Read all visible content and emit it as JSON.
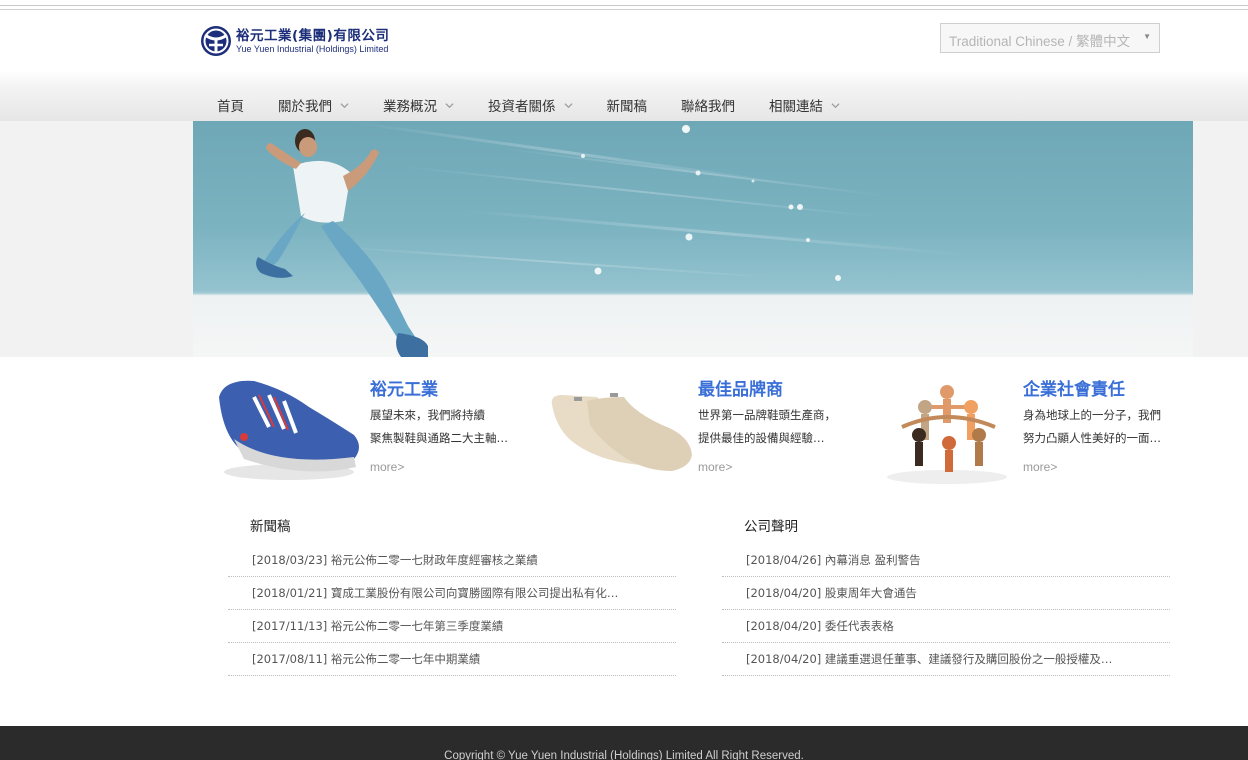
{
  "company": {
    "name_cn": "裕元工業(集團)有限公司",
    "name_en": "Yue Yuen Industrial (Holdings) Limited",
    "brand_color": "#1d2f7a"
  },
  "language": {
    "selected": "Traditional Chinese / 繁體中文"
  },
  "nav": {
    "items": [
      {
        "label": "首頁",
        "icon": ""
      },
      {
        "label": "關於我們",
        "icon": "chevron-down-icon"
      },
      {
        "label": "業務概況",
        "icon": "chevron-down-icon"
      },
      {
        "label": "投資者關係",
        "icon": "chevron-down-icon"
      },
      {
        "label": "新聞稿",
        "icon": ""
      },
      {
        "label": "聯絡我們",
        "icon": ""
      },
      {
        "label": "相關連結",
        "icon": "chevron-down-icon"
      }
    ]
  },
  "features": [
    {
      "title": "裕元工業",
      "line1": "展望未來，我們將持續",
      "line2": "聚焦製鞋與通路二大主軸…",
      "more": "more>",
      "image": "sneaker-image"
    },
    {
      "title": "最佳品牌商",
      "line1": "世界第一品牌鞋頭生產商，",
      "line2": "提供最佳的設備與經驗…",
      "more": "more>",
      "image": "shoe-last-image"
    },
    {
      "title": "企業社會責任",
      "line1": "身為地球上的一分子，我們",
      "line2": "努力凸顯人性美好的一面…",
      "more": "more>",
      "image": "paper-people-image"
    }
  ],
  "accent_color": "#3a6fd8",
  "press": {
    "heading": "新聞稿",
    "items": [
      "[2018/03/23] 裕元公佈二零一七財政年度經審核之業績",
      "[2018/01/21] 寶成工業股份有限公司向寶勝國際有限公司提出私有化…",
      "[2017/11/13] 裕元公佈二零一七年第三季度業績",
      "[2017/08/11] 裕元公佈二零一七年中期業績"
    ]
  },
  "announcements": {
    "heading": "公司聲明",
    "items": [
      "[2018/04/26] 內幕消息 盈利警告",
      "[2018/04/20] 股東周年大會通告",
      "[2018/04/20] 委任代表表格",
      "[2018/04/20] 建議重選退任董事、建議發行及購回股份之一般授權及…"
    ]
  },
  "footer": {
    "copyright": "Copyright © Yue Yuen Industrial (Holdings) Limited All Right Reserved."
  }
}
